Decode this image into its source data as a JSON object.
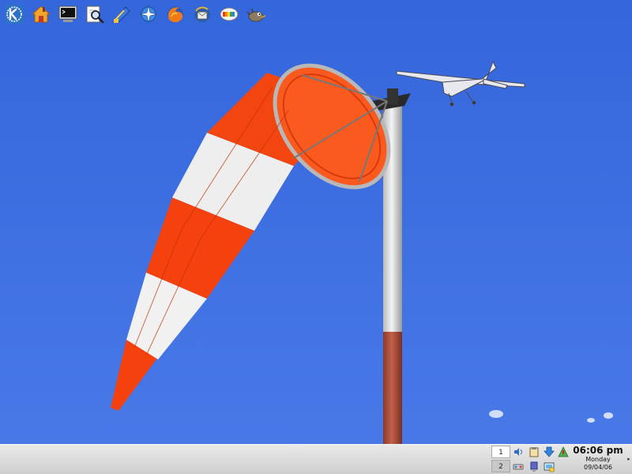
{
  "taskbar": {
    "launchers": [
      {
        "icon": "kde-menu-icon",
        "label": "K Menu"
      },
      {
        "icon": "home-folder-icon",
        "label": "Home"
      },
      {
        "icon": "terminal-icon",
        "label": "Terminal"
      },
      {
        "icon": "search-magnifier-icon",
        "label": "Find"
      },
      {
        "icon": "kdevelop-icon",
        "label": "Editor"
      },
      {
        "icon": "web-browser-konqueror-icon",
        "label": "Konqueror"
      },
      {
        "icon": "firefox-icon",
        "label": "Firefox"
      },
      {
        "icon": "thunderbird-icon",
        "label": "Thunderbird"
      },
      {
        "icon": "display-settings-icon",
        "label": "Display"
      },
      {
        "icon": "gimp-icon",
        "label": "GIMP"
      }
    ],
    "pager": {
      "desktops": [
        "1",
        "2"
      ],
      "active": "1"
    },
    "tray": {
      "icons": [
        "volume-icon",
        "klipper-icon",
        "download-icon",
        "network-icon",
        "media-icon",
        "usb-device-icon",
        "lock-icon"
      ]
    },
    "clock": {
      "time": "06:06 pm",
      "day": "Monday",
      "date": "09/04/06"
    },
    "hide_arrow": "▸"
  },
  "colors": {
    "sky": "#3e6fe0",
    "windsock_red": "#f5410e",
    "windsock_white": "#f2f2f2",
    "panel": "#dcdcdc"
  }
}
